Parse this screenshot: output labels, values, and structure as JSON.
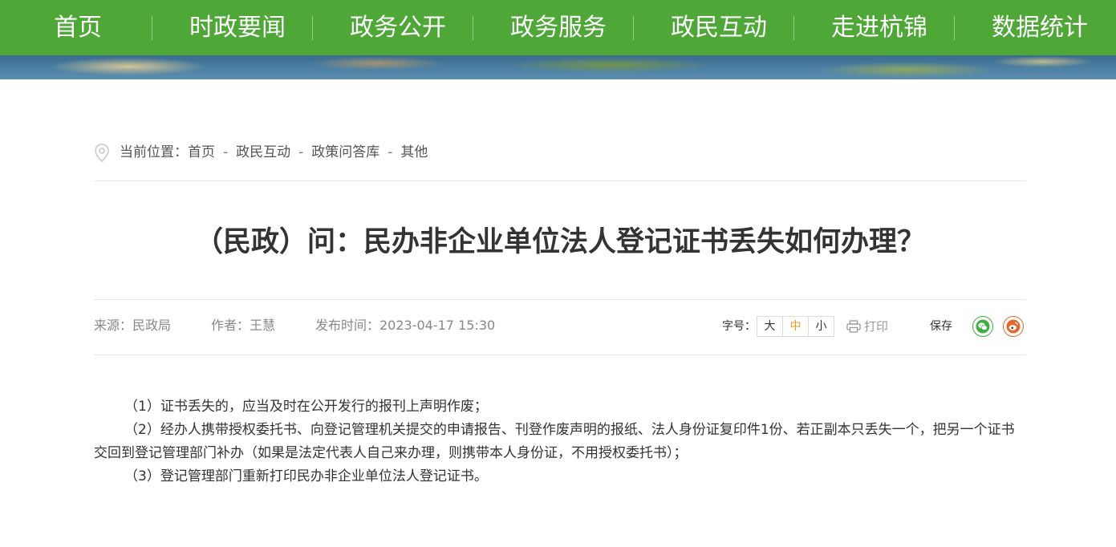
{
  "nav": {
    "items": [
      "首页",
      "时政要闻",
      "政务公开",
      "政务服务",
      "政民互动",
      "走进杭锦",
      "数据统计"
    ]
  },
  "breadcrumb": {
    "prefix": "当前位置：",
    "items": [
      "首页",
      "政民互动",
      "政策问答库",
      "其他"
    ],
    "separator": "-"
  },
  "article": {
    "title": "（民政）问：民办非企业单位法人登记证书丢失如何办理？",
    "source": "来源：民政局",
    "author": "作者：王慧",
    "published": "发布时间：2023-04-17 15:30",
    "paragraphs": [
      "（1）证书丢失的，应当及时在公开发行的报刊上声明作废；",
      "（2）经办人携带授权委托书、向登记管理机关提交的申请报告、刊登作废声明的报纸、法人身份证复印件1份、若正副本只丢失一个，把另一个证书交回到登记管理部门补办（如果是法定代表人自己来办理，则携带本人身份证，不用授权委托书）；",
      "（3）登记管理部门重新打印民办非企业单位法人登记证书。"
    ]
  },
  "tools": {
    "font_label": "字号：",
    "sizes": [
      "大",
      "中",
      "小"
    ],
    "active_size": "中",
    "print_label": "打印",
    "save_label": "保存",
    "share": [
      "wechat-icon",
      "weibo-icon"
    ]
  },
  "colors": {
    "nav_bg": "#4ea737",
    "active_size": "#e89a1c",
    "wechat": "#3dae3f",
    "weibo": "#e7682f"
  }
}
